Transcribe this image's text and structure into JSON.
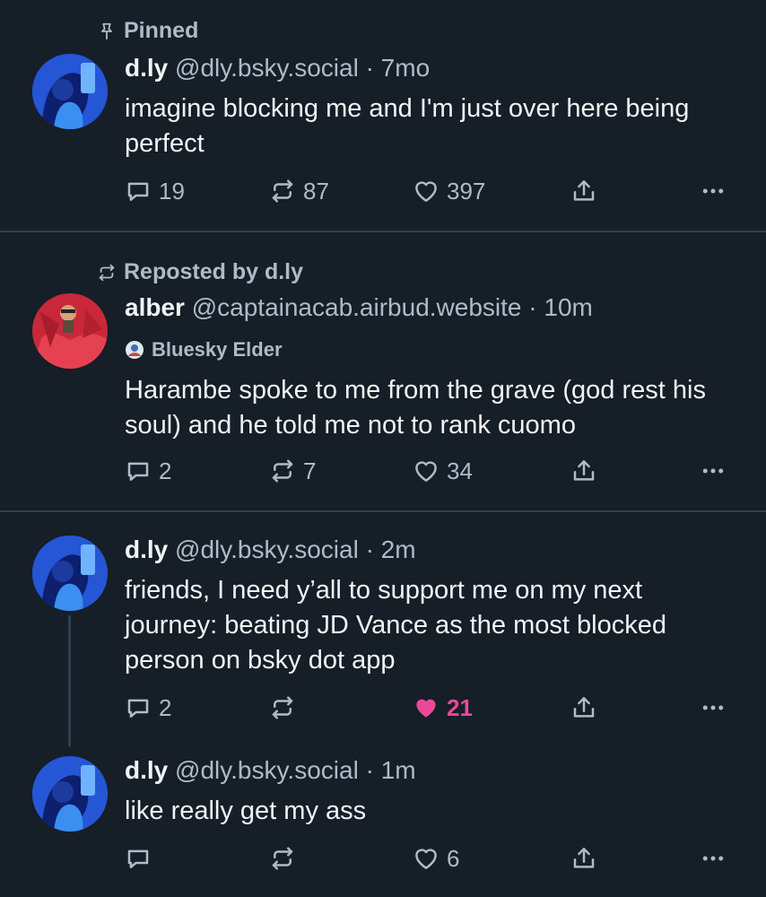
{
  "colors": {
    "background": "#161e27",
    "muted": "#aebbc9",
    "accent_like": "#ec4899",
    "divider": "#2e4052"
  },
  "posts": [
    {
      "context": {
        "icon": "pin-icon",
        "label": "Pinned"
      },
      "display_name": "d.ly",
      "handle": "@dly.bsky.social",
      "time": "· 7mo",
      "text": "imagine blocking me and I'm just over here being perfect",
      "replies": "19",
      "reposts": "87",
      "likes": "397"
    },
    {
      "context": {
        "icon": "repost-icon",
        "label": "Reposted by d.ly"
      },
      "display_name": "alber",
      "handle": "@captainacab.airbud.website",
      "time": "· 10m",
      "badge": "Bluesky Elder",
      "text": "Harambe spoke to me from the grave (god rest his soul) and he told me not to rank cuomo",
      "replies": "2",
      "reposts": "7",
      "likes": "34"
    },
    {
      "display_name": "d.ly",
      "handle": "@dly.bsky.social",
      "time": "· 2m",
      "text": "friends, I need y’all to support me on my next journey: beating JD Vance as the most blocked person on bsky dot app",
      "replies": "2",
      "reposts": "",
      "likes": "21",
      "liked": true
    },
    {
      "display_name": "d.ly",
      "handle": "@dly.bsky.social",
      "time": "· 1m",
      "text": "like really get my ass",
      "replies": "",
      "reposts": "",
      "likes": "6"
    }
  ]
}
